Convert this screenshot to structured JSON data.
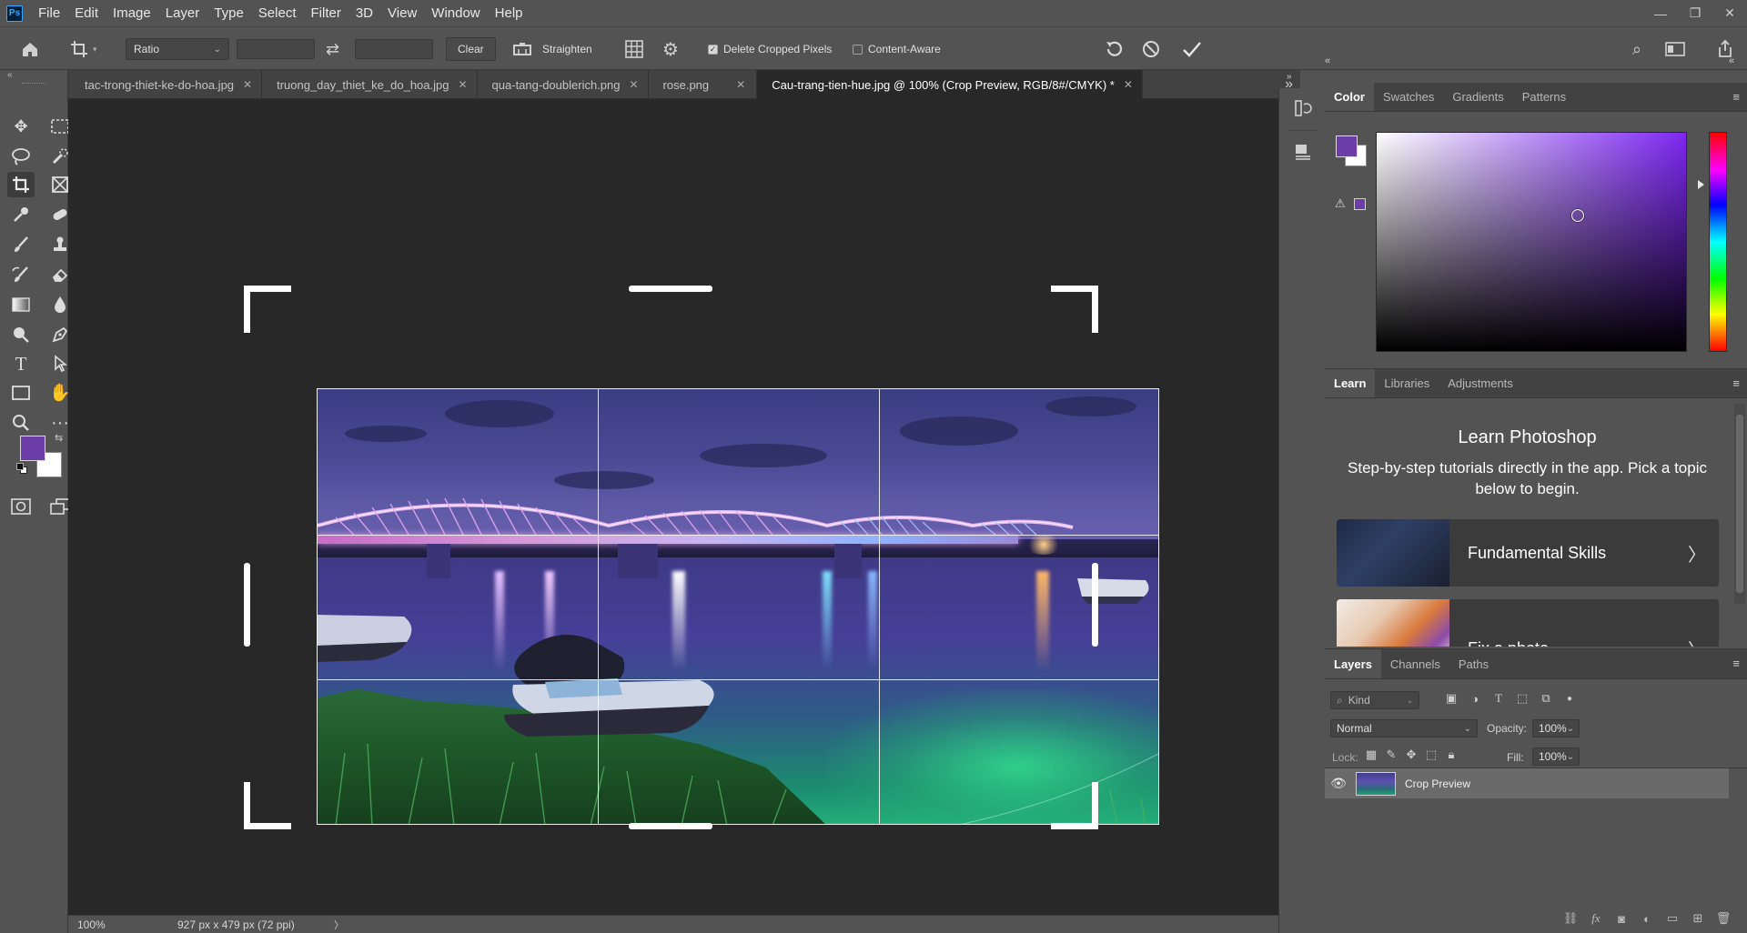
{
  "app": {
    "logo_text": "Ps"
  },
  "menu": [
    "File",
    "Edit",
    "Image",
    "Layer",
    "Type",
    "Select",
    "Filter",
    "3D",
    "View",
    "Window",
    "Help"
  ],
  "window_controls": {
    "minimize": "—",
    "restore": "❐",
    "close": "✕"
  },
  "options_bar": {
    "ratio_label": "Ratio",
    "width_value": "",
    "height_value": "",
    "swap_icon": "⇄",
    "clear_label": "Clear",
    "straighten_label": "Straighten",
    "delete_cropped_label": "Delete Cropped Pixels",
    "delete_cropped_checked": true,
    "content_aware_label": "Content-Aware",
    "content_aware_checked": false
  },
  "document_tabs": [
    {
      "title": "tac-trong-thiet-ke-do-hoa.jpg",
      "active": false
    },
    {
      "title": "truong_day_thiet_ke_do_hoa.jpg",
      "active": false
    },
    {
      "title": "qua-tang-doublerich.png",
      "active": false
    },
    {
      "title": "rose.png",
      "active": false
    },
    {
      "title": "Cau-trang-tien-hue.jpg @ 100% (Crop Preview, RGB/8#/CMYK) *",
      "active": true
    }
  ],
  "tab_close_glyph": "✕",
  "colors": {
    "foreground": "#6e3ea8",
    "background": "#ffffff",
    "ui_bg": "#535353",
    "canvas_bg": "#282828"
  },
  "status_bar": {
    "zoom": "100%",
    "doc_info": "927 px x 479 px (72 ppi)",
    "arrow": "〉"
  },
  "color_panel": {
    "tabs": [
      "Color",
      "Swatches",
      "Gradients",
      "Patterns"
    ],
    "active_tab": "Color",
    "menu_icon": "≡",
    "gamut_warning_icon": "⚠"
  },
  "learn_panel": {
    "tabs": [
      "Learn",
      "Libraries",
      "Adjustments"
    ],
    "active_tab": "Learn",
    "title": "Learn Photoshop",
    "description": "Step-by-step tutorials directly in the app. Pick a topic below to begin.",
    "cards": [
      {
        "label": "Fundamental Skills",
        "chevron": "〉"
      },
      {
        "label": "Fix a photo",
        "chevron": "〉"
      }
    ]
  },
  "layers_panel": {
    "tabs": [
      "Layers",
      "Channels",
      "Paths"
    ],
    "active_tab": "Layers",
    "filter_placeholder": "Kind",
    "blend_mode": "Normal",
    "opacity_label": "Opacity:",
    "opacity_value": "100%",
    "lock_label": "Lock:",
    "fill_label": "Fill:",
    "fill_value": "100%",
    "layers": [
      {
        "name": "Crop Preview",
        "visible": true
      }
    ],
    "bottom_icons": [
      "link-icon",
      "fx-icon",
      "mask-icon",
      "adjustment-icon",
      "group-icon",
      "new-layer-icon",
      "trash-icon"
    ]
  }
}
